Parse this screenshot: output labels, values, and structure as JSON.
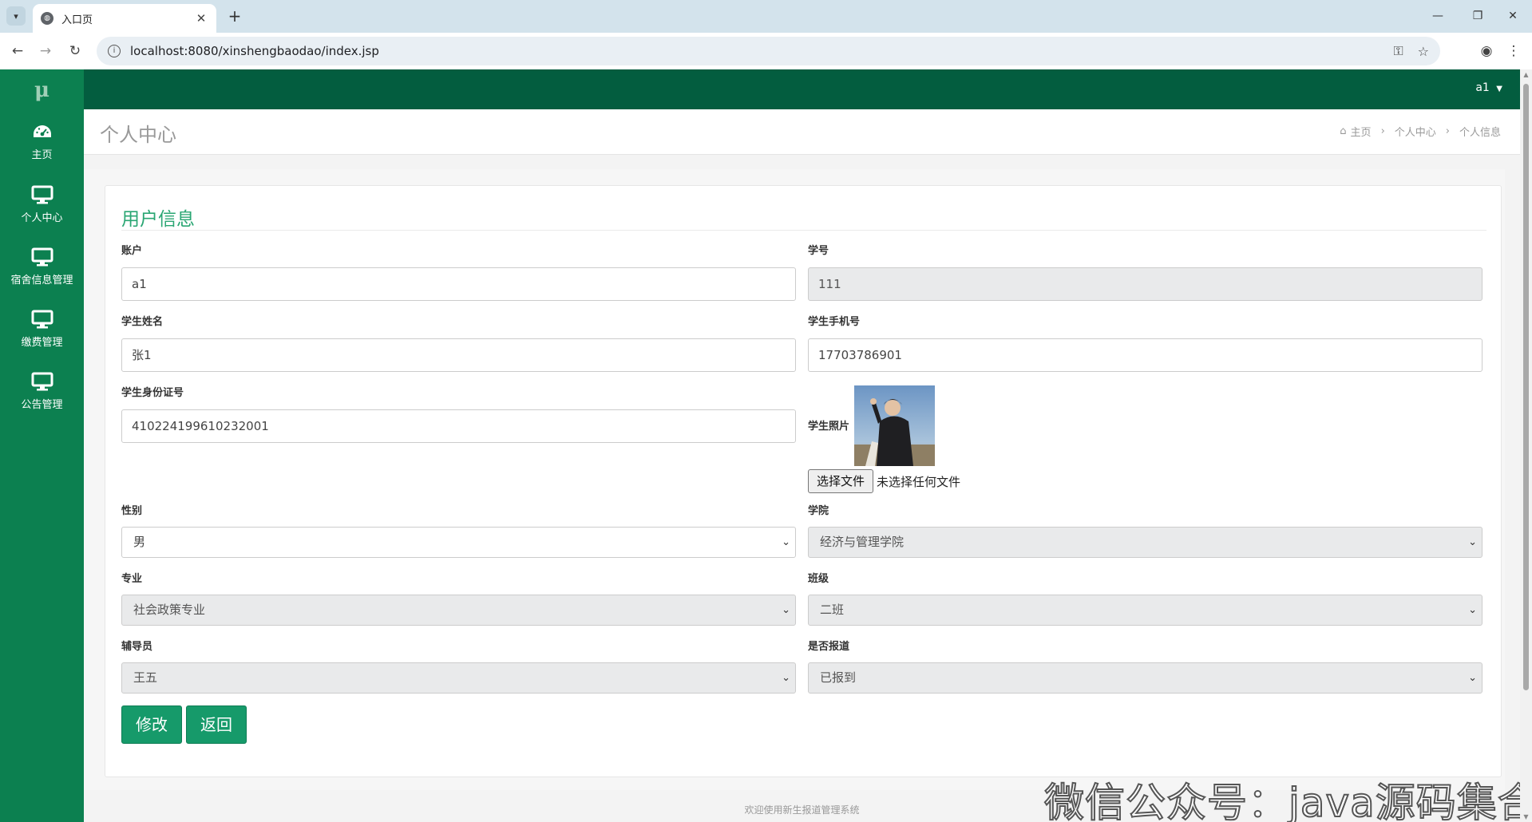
{
  "browser": {
    "tab_title": "入口页",
    "url": "localhost:8080/xinshengbaodao/index.jsp"
  },
  "app": {
    "logo": "μ",
    "user": "a1"
  },
  "sidebar": {
    "items": [
      {
        "label": "主页",
        "icon": "dashboard-icon"
      },
      {
        "label": "个人中心",
        "icon": "monitor-icon"
      },
      {
        "label": "宿舍信息管理",
        "icon": "monitor-icon"
      },
      {
        "label": "缴费管理",
        "icon": "monitor-icon"
      },
      {
        "label": "公告管理",
        "icon": "monitor-icon"
      }
    ]
  },
  "header": {
    "title": "个人中心",
    "breadcrumb": [
      "主页",
      "个人中心",
      "个人信息"
    ]
  },
  "form": {
    "title": "用户信息",
    "account_label": "账户",
    "account_value": "a1",
    "student_no_label": "学号",
    "student_no_value": "111",
    "name_label": "学生姓名",
    "name_value": "张1",
    "phone_label": "学生手机号",
    "phone_value": "17703786901",
    "id_label": "学生身份证号",
    "id_value": "410224199610232001",
    "photo_label": "学生照片",
    "file_button": "选择文件",
    "file_status": "未选择任何文件",
    "gender_label": "性别",
    "gender_value": "男",
    "college_label": "学院",
    "college_value": "经济与管理学院",
    "major_label": "专业",
    "major_value": "社会政策专业",
    "class_label": "班级",
    "class_value": "二班",
    "counselor_label": "辅导员",
    "counselor_value": "王五",
    "reported_label": "是否报道",
    "reported_value": "已报到",
    "submit_label": "修改",
    "back_label": "返回"
  },
  "footer": "欢迎使用新生报道管理系统",
  "watermark": "微信公众号：java源码集合",
  "colors": {
    "sidebar": "#0c8050",
    "topbar": "#035d3f",
    "accent": "#2aa673",
    "button": "#169a6a"
  }
}
